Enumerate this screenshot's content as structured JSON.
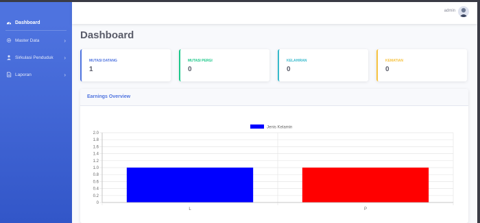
{
  "sidebar": {
    "brand": "Dashboard",
    "items": [
      {
        "label": "Master Data",
        "icon": "gear-icon"
      },
      {
        "label": "Sirkulasi Penduduk",
        "icon": "user-icon"
      },
      {
        "label": "Laporan",
        "icon": "file-icon"
      }
    ]
  },
  "topbar": {
    "user": "admin"
  },
  "page": {
    "title": "Dashboard"
  },
  "cards": [
    {
      "label": "MUTASI DATANG",
      "value": "1",
      "color": "#4e73df"
    },
    {
      "label": "MUTASI PERGI",
      "value": "0",
      "color": "#1cc88a"
    },
    {
      "label": "KELAHIRAN",
      "value": "0",
      "color": "#36b9cc"
    },
    {
      "label": "KEMATIAN",
      "value": "0",
      "color": "#f6c23e"
    }
  ],
  "chart_card": {
    "title": "Earnings Overview"
  },
  "chart_data": {
    "type": "bar",
    "categories": [
      "L",
      "P"
    ],
    "series": [
      {
        "name": "Jenis Kelamin",
        "values": [
          1,
          1
        ],
        "colors": [
          "#0000ff",
          "#ff0000"
        ]
      }
    ],
    "ylim": [
      0,
      2.0
    ],
    "yticks": [
      "0",
      "0.2",
      "0.4",
      "0.6",
      "0.8",
      "1.0",
      "1.2",
      "1.4",
      "1.6",
      "1.8",
      "2.0"
    ],
    "grid": true,
    "legend": "top-center"
  }
}
